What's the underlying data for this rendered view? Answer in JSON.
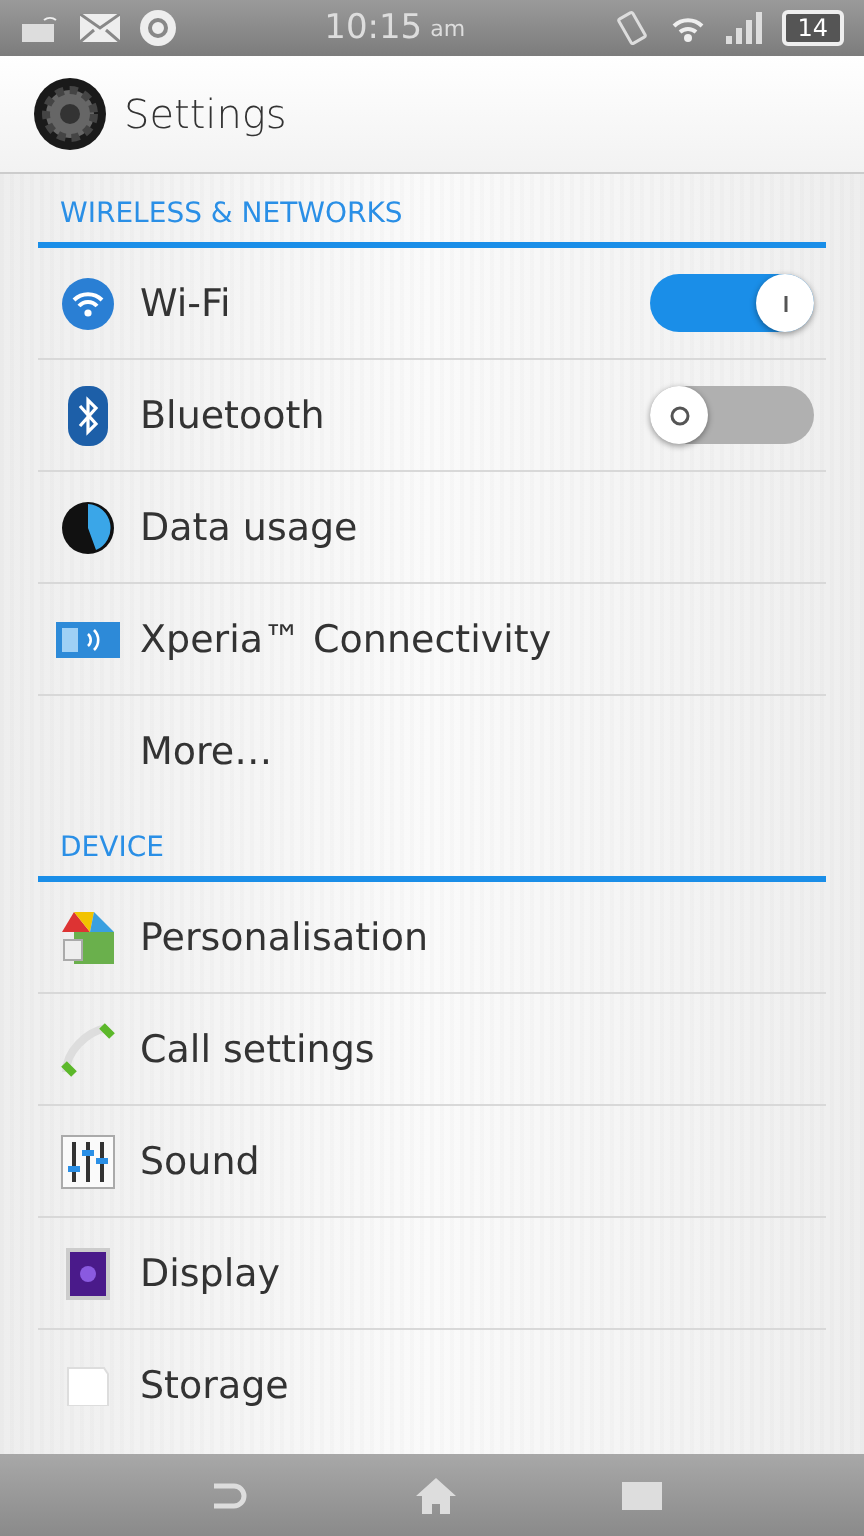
{
  "status_bar": {
    "time": "10:15",
    "meridiem": "am",
    "battery": "14"
  },
  "header": {
    "title": "Settings"
  },
  "sections": [
    {
      "title": "WIRELESS & NETWORKS",
      "items": [
        {
          "label": "Wi-Fi",
          "kind": "toggle",
          "on": true
        },
        {
          "label": "Bluetooth",
          "kind": "toggle",
          "on": false
        },
        {
          "label": "Data usage",
          "kind": "link"
        },
        {
          "label": "Xperia™ Connectivity",
          "kind": "link"
        },
        {
          "label": "More…",
          "kind": "link"
        }
      ]
    },
    {
      "title": "DEVICE",
      "items": [
        {
          "label": "Personalisation",
          "kind": "link"
        },
        {
          "label": "Call settings",
          "kind": "link"
        },
        {
          "label": "Sound",
          "kind": "link"
        },
        {
          "label": "Display",
          "kind": "link"
        },
        {
          "label": "Storage",
          "kind": "link"
        }
      ]
    }
  ]
}
